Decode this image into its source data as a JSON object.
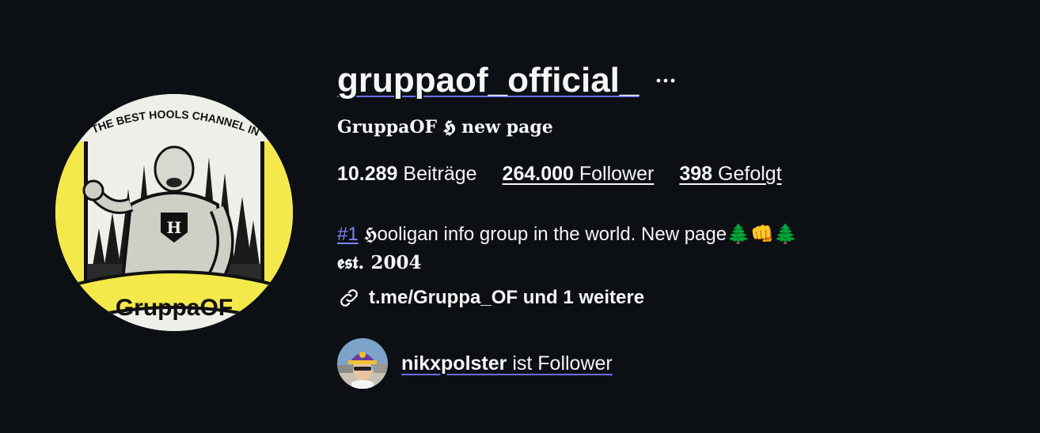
{
  "profile": {
    "username": "gruppaof_official_",
    "more_icon": "more-horizontal-icon",
    "display_name": "GruppaOF 𝕳 new page",
    "stats": {
      "posts_count": "10.289",
      "posts_label": "Beiträge",
      "followers_count": "264.000",
      "followers_label": "Follower",
      "following_count": "398",
      "following_label": "Gefolgt"
    },
    "bio": {
      "hashtag": "#1",
      "line1": " 𝕳ooligan info group in the world. New page🌲👊🌲",
      "line2": "𝖊𝖘𝖙. 2004"
    },
    "link": {
      "icon": "link-icon",
      "text": "t.me/Gruppa_OF und 1 weitere"
    },
    "followed_by": {
      "username": "nikxpolster",
      "suffix": " ist Follower"
    },
    "avatar": {
      "top_text": "THE BEST HOOLS CHANNEL IN THE WORLD",
      "banner_text": "GruppaOF",
      "shield_letter": "H"
    }
  }
}
